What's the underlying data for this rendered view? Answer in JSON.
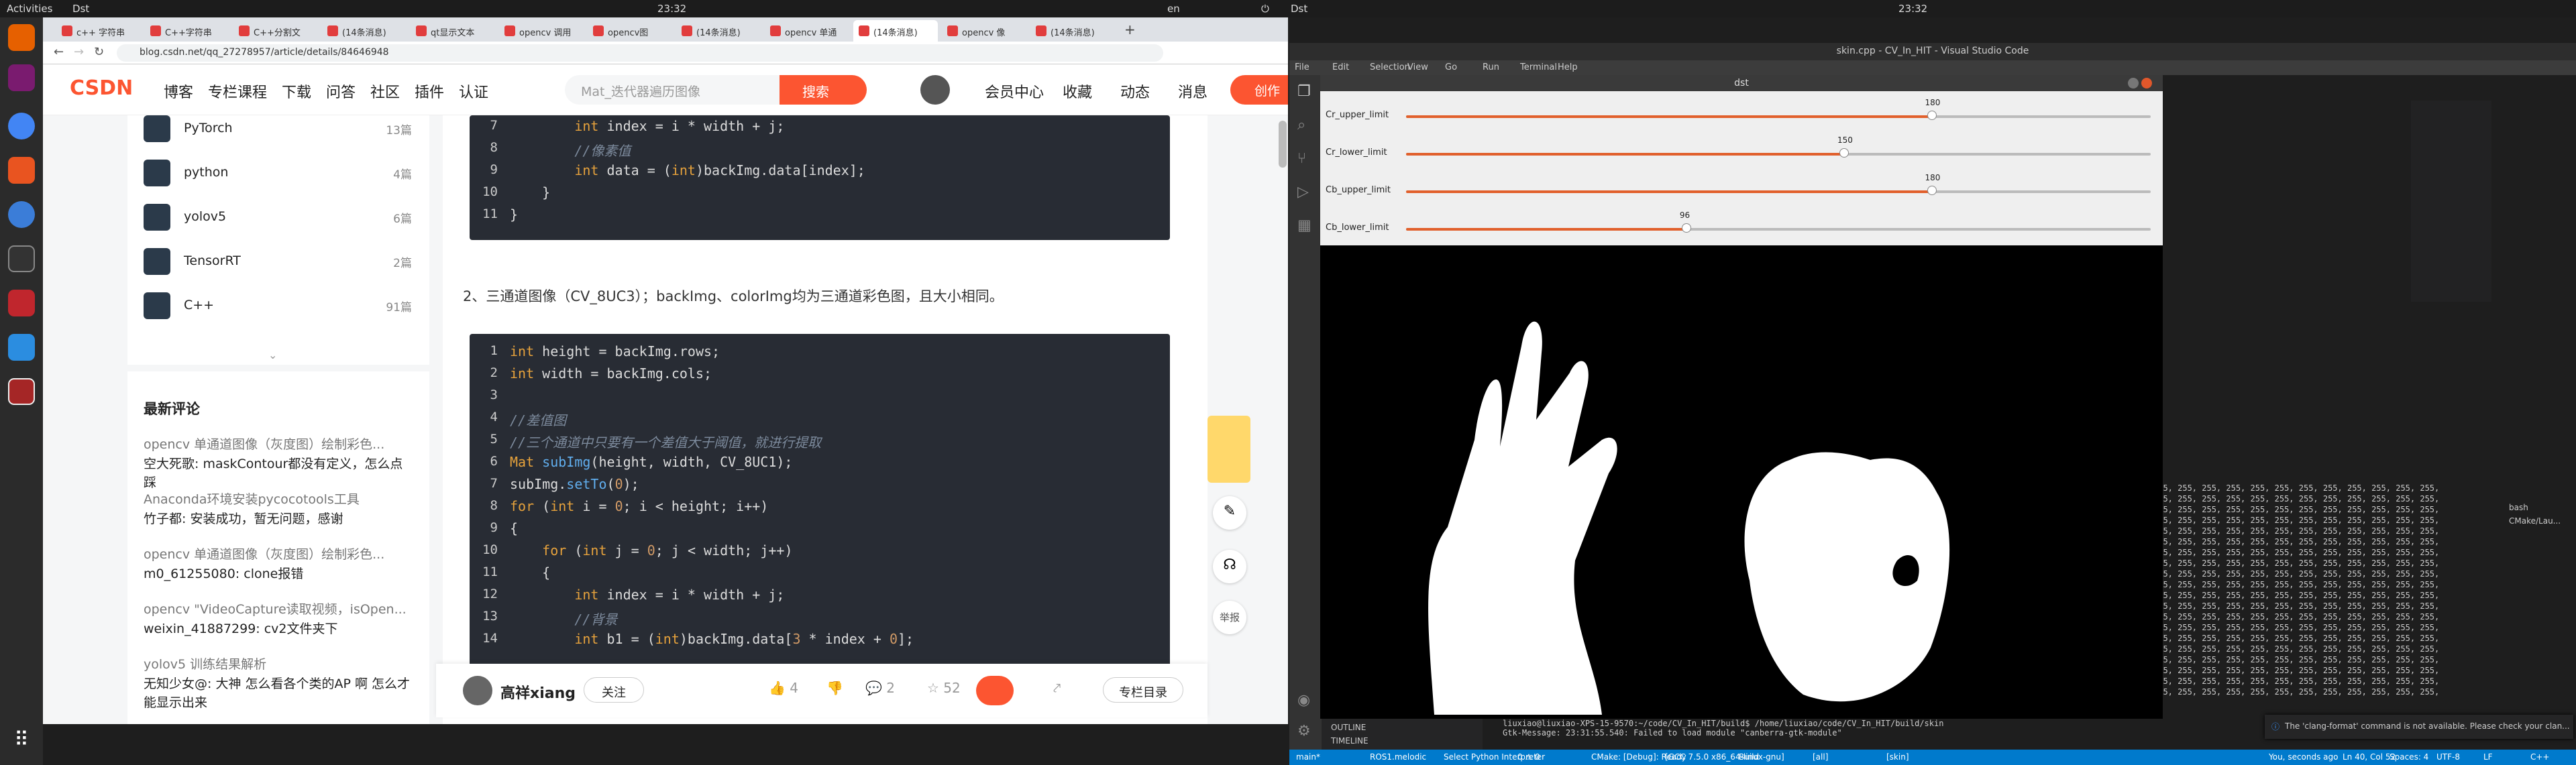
{
  "topbar": {
    "activities": "Activities",
    "app": "Dst",
    "clock": "23:32",
    "lang": "en"
  },
  "browser": {
    "tabs": [
      "c++ 字符串",
      "C++字符串",
      "C++分割文",
      "(14条消息)",
      "qt显示文本",
      "opencv 调用",
      "opencv图",
      "(14条消息)",
      "opencv 单通",
      "(14条消息)",
      "opencv 像",
      "(14条消息)"
    ],
    "url": "blog.csdn.net/qq_27278957/article/details/84646948"
  },
  "csdn": {
    "logo": "CSDN",
    "nav": [
      "博客",
      "专栏课程",
      "下载",
      "问答",
      "社区",
      "插件",
      "认证"
    ],
    "search_placeholder": "Mat_迭代器遍历图像",
    "search_button": "搜索",
    "right_nav": [
      "会员中心",
      "收藏",
      "动态",
      "消息"
    ],
    "create": "创作"
  },
  "columns": [
    {
      "name": "PyTorch",
      "count": "13篇"
    },
    {
      "name": "python",
      "count": "4篇"
    },
    {
      "name": "yolov5",
      "count": "6篇"
    },
    {
      "name": "TensorRT",
      "count": "2篇"
    },
    {
      "name": "C++",
      "count": "91篇"
    }
  ],
  "recent_comments": {
    "title": "最新评论",
    "items": [
      {
        "article": "opencv 单通道图像（灰度图）绘制彩色...",
        "comment": "空大死歌: maskContour都没有定义，怎么点踩"
      },
      {
        "article": "Anaconda环境安装pycocotools工具",
        "comment": "竹子都: 安装成功，暂无问题，感谢"
      },
      {
        "article": "opencv 单通道图像（灰度图）绘制彩色...",
        "comment": "m0_61255080: clone报错"
      },
      {
        "article": "opencv \"VideoCapture读取视频，isOpen...",
        "comment": "weixin_41887299: cv2文件夹下"
      },
      {
        "article": "yolov5 训练结果解析",
        "comment": "无知少女@: 大神 怎么看各个类的AP 啊 怎么才能显示出来"
      }
    ]
  },
  "code_top": {
    "lines": [
      {
        "n": "7",
        "t": "        int index = i * width + j;"
      },
      {
        "n": "8",
        "t": "        //像素值"
      },
      {
        "n": "9",
        "t": "        int data = (int)backImg.data[index];"
      },
      {
        "n": "10",
        "t": "    }"
      },
      {
        "n": "11",
        "t": "}"
      }
    ]
  },
  "paragraph": "2、三通道图像（CV_8UC3）；backImg、colorImg均为三通道彩色图，且大小相同。",
  "code_main": {
    "lines": [
      {
        "n": "1",
        "t": "int height = backImg.rows;"
      },
      {
        "n": "2",
        "t": "int width = backImg.cols;"
      },
      {
        "n": "3",
        "t": ""
      },
      {
        "n": "4",
        "t": "//差值图"
      },
      {
        "n": "5",
        "t": "//三个通道中只要有一个差值大于阈值，就进行提取"
      },
      {
        "n": "6",
        "t": "Mat subImg(height, width, CV_8UC1);"
      },
      {
        "n": "7",
        "t": "subImg.setTo(0);"
      },
      {
        "n": "8",
        "t": "for (int i = 0; i < height; i++)"
      },
      {
        "n": "9",
        "t": "{"
      },
      {
        "n": "10",
        "t": "    for (int j = 0; j < width; j++)"
      },
      {
        "n": "11",
        "t": "    {"
      },
      {
        "n": "12",
        "t": "        int index = i * width + j;"
      },
      {
        "n": "13",
        "t": "        //背景"
      },
      {
        "n": "14",
        "t": "        int b1 = (int)backImg.data[3 * index + 0];"
      }
    ]
  },
  "author": {
    "name": "高祥xiang",
    "follow": "关注",
    "likes": "4",
    "comments": "2",
    "stars": "52",
    "catalog": "专栏目录"
  },
  "float": {
    "report": "举报"
  },
  "vscode": {
    "title": "skin.cpp - CV_In_HIT - Visual Studio Code",
    "menu": [
      "File",
      "Edit",
      "Selection",
      "View",
      "Go",
      "Run",
      "Terminal",
      "Help"
    ],
    "panels": [
      "OUTLINE",
      "TIMELINE"
    ],
    "terminal_tabs": [
      "bash",
      "CMake/Lau..."
    ],
    "terminal_row": "255, 255, 255, 255, 255, 255, 255, 255, 255, 255, 255, 255,",
    "cmd1": "liuxiao@liuxiao-XPS-15-9570:~/code/CV_In_HIT/build$ /home/liuxiao/code/CV_In_HIT/build/skin",
    "cmd2": "Gtk-Message: 23:31:55.540: Failed to load module \"canberra-gtk-module\"",
    "notification": "The 'clang-format' command is not available. Please check your clan...",
    "status_left": [
      "main*",
      "ROS1.melodic",
      "Select Python Interpreter",
      "0 ⚠ 0",
      "CMake: [Debug]: Ready",
      "[GCC 7.5.0 x86_64-linux-gnu]",
      "Build",
      "[all]",
      "[skin]"
    ],
    "status_right": [
      "You, seconds ago",
      "Ln 40, Col 52",
      "Spaces: 4",
      "UTF-8",
      "LF",
      "C++",
      "Linux"
    ]
  },
  "dst": {
    "title": "dst"
  },
  "trackbars": [
    {
      "label": "Cr_upper_limit",
      "value": 180,
      "max": 255
    },
    {
      "label": "Cr_lower_limit",
      "value": 150,
      "max": 255
    },
    {
      "label": "Cb_upper_limit",
      "value": 180,
      "max": 255
    },
    {
      "label": "Cb_lower_limit",
      "value": 96,
      "max": 255
    }
  ],
  "colors": {
    "csdn_red": "#fc5531",
    "vscode_blue": "#007acc",
    "trackbar": "#e1602c"
  }
}
